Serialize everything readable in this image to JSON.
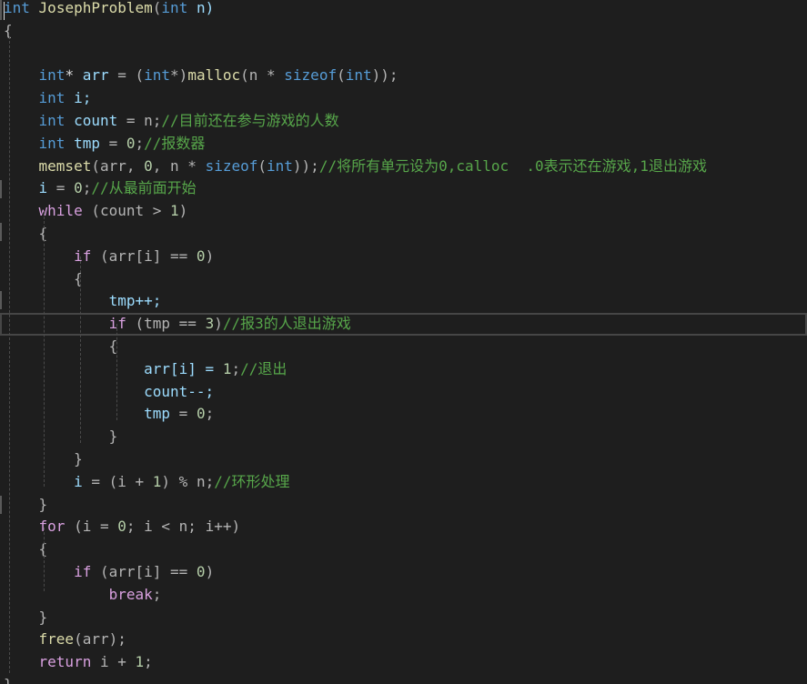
{
  "code_lines": [
    [
      {
        "t": "int",
        "c": "kw"
      },
      {
        "t": " ",
        "c": "plain"
      },
      {
        "t": "JosephProblem",
        "c": "fn"
      },
      {
        "t": "(",
        "c": "op"
      },
      {
        "t": "int",
        "c": "kw"
      },
      {
        "t": " n)",
        "c": "var"
      }
    ],
    [
      {
        "t": "{",
        "c": "op"
      }
    ],
    [],
    [
      {
        "t": "    ",
        "c": "plain"
      },
      {
        "t": "int",
        "c": "kw"
      },
      {
        "t": "* ",
        "c": "plain"
      },
      {
        "t": "arr",
        "c": "var"
      },
      {
        "t": " = (",
        "c": "op"
      },
      {
        "t": "int",
        "c": "kw"
      },
      {
        "t": "*)",
        "c": "op"
      },
      {
        "t": "malloc",
        "c": "fn"
      },
      {
        "t": "(n * ",
        "c": "op"
      },
      {
        "t": "sizeof",
        "c": "kw"
      },
      {
        "t": "(",
        "c": "op"
      },
      {
        "t": "int",
        "c": "kw"
      },
      {
        "t": "));",
        "c": "op"
      }
    ],
    [
      {
        "t": "    ",
        "c": "plain"
      },
      {
        "t": "int",
        "c": "kw"
      },
      {
        "t": " i;",
        "c": "var"
      }
    ],
    [
      {
        "t": "    ",
        "c": "plain"
      },
      {
        "t": "int",
        "c": "kw"
      },
      {
        "t": " count",
        "c": "var"
      },
      {
        "t": " = n;",
        "c": "op"
      },
      {
        "t": "//目前还在参与游戏的人数",
        "c": "cm"
      }
    ],
    [
      {
        "t": "    ",
        "c": "plain"
      },
      {
        "t": "int",
        "c": "kw"
      },
      {
        "t": " tmp",
        "c": "var"
      },
      {
        "t": " = ",
        "c": "op"
      },
      {
        "t": "0",
        "c": "num"
      },
      {
        "t": ";",
        "c": "op"
      },
      {
        "t": "//报数器",
        "c": "cm"
      }
    ],
    [
      {
        "t": "    ",
        "c": "plain"
      },
      {
        "t": "memset",
        "c": "fn"
      },
      {
        "t": "(arr, ",
        "c": "op"
      },
      {
        "t": "0",
        "c": "num"
      },
      {
        "t": ", n * ",
        "c": "op"
      },
      {
        "t": "sizeof",
        "c": "kw"
      },
      {
        "t": "(",
        "c": "op"
      },
      {
        "t": "int",
        "c": "kw"
      },
      {
        "t": "));",
        "c": "op"
      },
      {
        "t": "//将所有单元设为0,calloc  .0表示还在游戏,1退出游戏",
        "c": "cm"
      }
    ],
    [
      {
        "t": "    ",
        "c": "plain"
      },
      {
        "t": "i",
        "c": "var"
      },
      {
        "t": " = ",
        "c": "op"
      },
      {
        "t": "0",
        "c": "num"
      },
      {
        "t": ";",
        "c": "op"
      },
      {
        "t": "//从最前面开始",
        "c": "cm"
      }
    ],
    [
      {
        "t": "    ",
        "c": "plain"
      },
      {
        "t": "while",
        "c": "ctrl"
      },
      {
        "t": " (count > ",
        "c": "op"
      },
      {
        "t": "1",
        "c": "num"
      },
      {
        "t": ")",
        "c": "op"
      }
    ],
    [
      {
        "t": "    {",
        "c": "op"
      }
    ],
    [
      {
        "t": "        ",
        "c": "plain"
      },
      {
        "t": "if",
        "c": "ctrl"
      },
      {
        "t": " (arr[i] == ",
        "c": "op"
      },
      {
        "t": "0",
        "c": "num"
      },
      {
        "t": ")",
        "c": "op"
      }
    ],
    [
      {
        "t": "        {",
        "c": "op"
      }
    ],
    [
      {
        "t": "            ",
        "c": "plain"
      },
      {
        "t": "tmp++;",
        "c": "var"
      }
    ],
    [
      {
        "t": "            ",
        "c": "plain"
      },
      {
        "t": "if",
        "c": "ctrl"
      },
      {
        "t": " (tmp == ",
        "c": "op"
      },
      {
        "t": "3",
        "c": "num"
      },
      {
        "t": ")",
        "c": "op"
      },
      {
        "t": "//报3的人退出游戏",
        "c": "cm"
      }
    ],
    [
      {
        "t": "            {",
        "c": "op"
      }
    ],
    [
      {
        "t": "                ",
        "c": "plain"
      },
      {
        "t": "arr[i] = ",
        "c": "var"
      },
      {
        "t": "1",
        "c": "num"
      },
      {
        "t": ";",
        "c": "op"
      },
      {
        "t": "//退出",
        "c": "cm"
      }
    ],
    [
      {
        "t": "                ",
        "c": "plain"
      },
      {
        "t": "count--;",
        "c": "var"
      }
    ],
    [
      {
        "t": "                ",
        "c": "plain"
      },
      {
        "t": "tmp",
        "c": "var"
      },
      {
        "t": " = ",
        "c": "op"
      },
      {
        "t": "0",
        "c": "num"
      },
      {
        "t": ";",
        "c": "op"
      }
    ],
    [
      {
        "t": "            }",
        "c": "op"
      }
    ],
    [
      {
        "t": "        }",
        "c": "op"
      }
    ],
    [
      {
        "t": "        ",
        "c": "plain"
      },
      {
        "t": "i",
        "c": "var"
      },
      {
        "t": " = (i + ",
        "c": "op"
      },
      {
        "t": "1",
        "c": "num"
      },
      {
        "t": ") % n;",
        "c": "op"
      },
      {
        "t": "//环形处理",
        "c": "cm"
      }
    ],
    [
      {
        "t": "    }",
        "c": "op"
      }
    ],
    [
      {
        "t": "    ",
        "c": "plain"
      },
      {
        "t": "for",
        "c": "ctrl"
      },
      {
        "t": " (i = ",
        "c": "op"
      },
      {
        "t": "0",
        "c": "num"
      },
      {
        "t": "; i < n; i++)",
        "c": "op"
      }
    ],
    [
      {
        "t": "    {",
        "c": "op"
      }
    ],
    [
      {
        "t": "        ",
        "c": "plain"
      },
      {
        "t": "if",
        "c": "ctrl"
      },
      {
        "t": " (arr[i] == ",
        "c": "op"
      },
      {
        "t": "0",
        "c": "num"
      },
      {
        "t": ")",
        "c": "op"
      }
    ],
    [
      {
        "t": "            ",
        "c": "plain"
      },
      {
        "t": "break",
        "c": "ctrl"
      },
      {
        "t": ";",
        "c": "op"
      }
    ],
    [
      {
        "t": "    }",
        "c": "op"
      }
    ],
    [
      {
        "t": "    ",
        "c": "plain"
      },
      {
        "t": "free",
        "c": "fn"
      },
      {
        "t": "(arr);",
        "c": "op"
      }
    ],
    [
      {
        "t": "    ",
        "c": "plain"
      },
      {
        "t": "return",
        "c": "ctrl"
      },
      {
        "t": " i + ",
        "c": "op"
      },
      {
        "t": "1",
        "c": "num"
      },
      {
        "t": ";",
        "c": "op"
      }
    ],
    [
      {
        "t": "}",
        "c": "op"
      }
    ]
  ],
  "current_line_index": 14,
  "colors": {
    "background": "#1e1e1e",
    "keyword": "#569cd6",
    "control": "#d8a0df",
    "function": "#dcdcaa",
    "variable": "#9cdcfe",
    "number": "#b5cea8",
    "comment": "#57a64a",
    "operator": "#b4b4b4"
  }
}
